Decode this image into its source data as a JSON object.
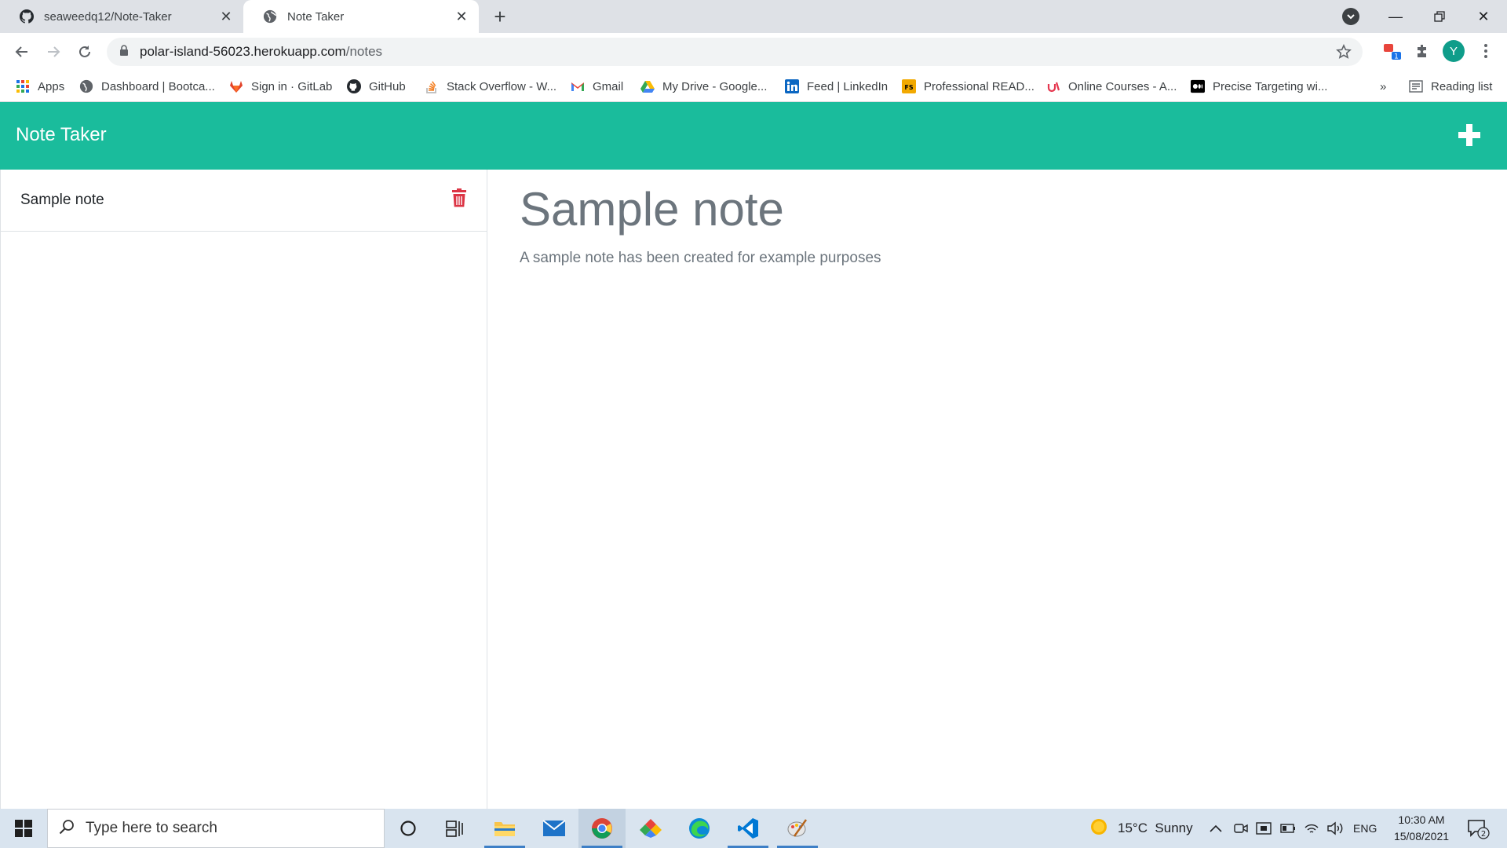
{
  "browser": {
    "tabs": [
      {
        "title": "seaweedq12/Note-Taker",
        "icon": "github-icon"
      },
      {
        "title": "Note Taker",
        "icon": "globe-icon",
        "active": true
      }
    ],
    "url_host": "polar-island-56023.herokuapp.com",
    "url_path": "/notes",
    "profile_initial": "Y",
    "extension_badge": "1"
  },
  "bookmarks": {
    "items": [
      {
        "label": "Apps",
        "icon": "apps-grid-icon"
      },
      {
        "label": "Dashboard | Bootca...",
        "icon": "globe-icon"
      },
      {
        "label": "Sign in · GitLab",
        "icon": "gitlab-icon"
      },
      {
        "label": "GitHub",
        "icon": "github-icon"
      },
      {
        "label": "Stack Overflow - W...",
        "icon": "stackoverflow-icon"
      },
      {
        "label": "Gmail",
        "icon": "gmail-icon"
      },
      {
        "label": "My Drive - Google...",
        "icon": "google-drive-icon"
      },
      {
        "label": "Feed | LinkedIn",
        "icon": "linkedin-icon"
      },
      {
        "label": "Professional READ...",
        "icon": "fs-icon"
      },
      {
        "label": "Online Courses - A...",
        "icon": "udemy-icon"
      },
      {
        "label": "Precise Targeting wi...",
        "icon": "medium-icon"
      }
    ],
    "overflow": "»",
    "reading_list": "Reading list"
  },
  "app": {
    "brand": "Note Taker",
    "add_icon": "plus-icon",
    "accent_color": "#1abc9c",
    "delete_color": "#dc3545"
  },
  "notes": [
    {
      "title": "Sample note"
    }
  ],
  "active_note": {
    "title": "Sample note",
    "text": "A sample note has been created  for example purposes"
  },
  "taskbar": {
    "search_placeholder": "Type here to search",
    "weather": "15°C  Sunny",
    "language": "ENG",
    "time": "10:30 AM",
    "date": "15/08/2021",
    "notification_count": "2"
  }
}
